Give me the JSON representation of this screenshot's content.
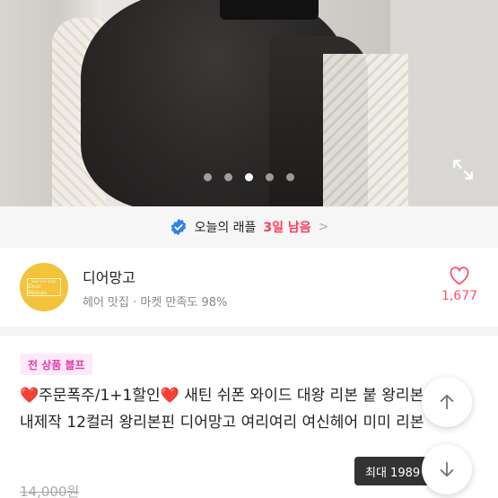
{
  "gallery": {
    "slide_count": 5,
    "active_index": 2
  },
  "raffle": {
    "label": "오늘의 래플",
    "days_left": "3일 남음",
    "chevron": ">"
  },
  "shop": {
    "logo_tiny": "Hair acc shop",
    "logo_brand": "Dear Mango",
    "name": "디어망고",
    "description": "헤어 맛집 · 마켓 만족도 98%",
    "likes": "1,677"
  },
  "product": {
    "tag": "전 상품 블프",
    "title": "❤️주문폭주/1+1할인❤️ 새틴 쉬폰 와이드 대왕 리본 붙 왕리본 국내제작 12컬러 왕리본핀 디어망고 여리여리 여신헤어 미미 리본",
    "original_price": "14,000원",
    "max_discount_toast": "최대 1989"
  },
  "colors": {
    "accent": "#ff4f6a",
    "days": "#ff3b5c",
    "tag_text": "#e23cab",
    "tag_bg": "#fdeaf8",
    "logo_bg": "#f2c33b"
  },
  "icons": [
    "expand-icon",
    "verified-check-icon",
    "chevron-right-icon",
    "heart-icon",
    "arrow-up-icon",
    "arrow-down-icon"
  ]
}
